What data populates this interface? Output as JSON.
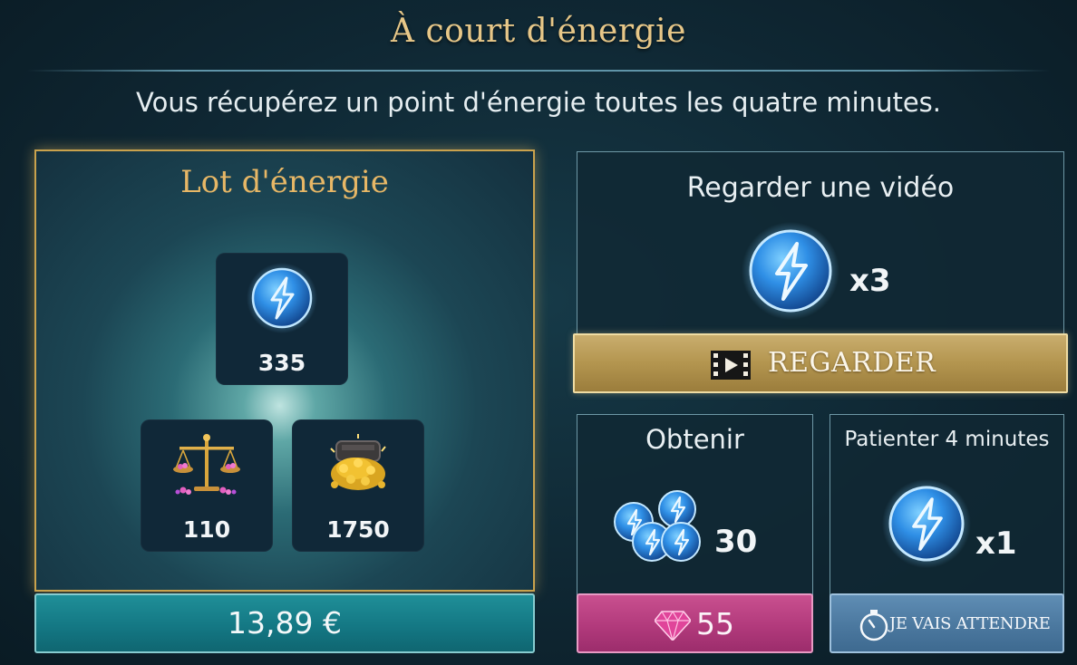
{
  "header": {
    "title": "À court d'énergie",
    "subtitle": "Vous récupérez un point d'énergie toutes les quatre minutes."
  },
  "bundle": {
    "title": "Lot d'énergie",
    "items": [
      {
        "icon": "energy-orb-icon",
        "quantity": "335"
      },
      {
        "icon": "scales-with-gems-icon",
        "quantity": "110"
      },
      {
        "icon": "gold-coins-pile-icon",
        "quantity": "1750"
      }
    ],
    "price": "13,89 €"
  },
  "video": {
    "title": "Regarder une vidéo",
    "reward": "x3",
    "button_label": "REGARDER",
    "button_icon": "film-icon"
  },
  "obtain": {
    "title": "Obtenir",
    "reward": "30",
    "price": "55",
    "price_icon": "gem-icon"
  },
  "wait": {
    "title": "Patienter 4 minutes",
    "reward": "x1",
    "button_label": "JE VAIS ATTENDRE",
    "button_icon": "stopwatch-icon"
  },
  "colors": {
    "gold_accent": "#e7c788",
    "bundle_button": "#147884",
    "watch_button": "#b3954f",
    "gem_button": "#b23a7c",
    "wait_button": "#4b789f",
    "energy_blue": "#2f8fe6"
  }
}
